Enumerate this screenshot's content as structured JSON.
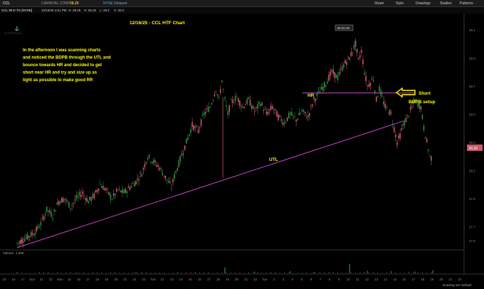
{
  "toolbar": {
    "symbol": "CCL",
    "company": "CARNIVAL CORP",
    "price": "28.20",
    "exchange": "NYSE Delayed",
    "share": "Share",
    "style": "Style",
    "drawings": "Drawings",
    "studies": "Studies",
    "patterns": "Patterns"
  },
  "infobar": {
    "desc": "CCL 30 D 7m [NYSE]",
    "date": "12/16/25 4:51 PM",
    "o": "O: 28.25",
    "h": "H: 28.26",
    "l": "L: 28.2",
    "c": "C: 28.2"
  },
  "logo_text": "CARNIVAL",
  "volume": {
    "label": "Volume",
    "value": "1,000"
  },
  "status": {
    "drawing_set": "Drawing set: Default"
  },
  "colors": {
    "up": "#2e8b3e",
    "down": "#c8586b",
    "trendline": "#cc44cc",
    "annotation": "#ffff00"
  },
  "chart_data": {
    "type": "candlestick",
    "title": "12/16/25 - CCL HTF Chart",
    "ylim": [
      27.55,
      29.2
    ],
    "y_ticks": [
      "29.1",
      "28.9",
      "28.7",
      "28.5",
      "28.3",
      "28.1",
      "27.9",
      "27.7",
      "27.6"
    ],
    "y_tick_values": [
      29.1,
      28.9,
      28.7,
      28.5,
      28.3,
      28.1,
      27.9,
      27.7,
      27.6
    ],
    "x_ticks": [
      "15",
      "16",
      "17",
      "Sun",
      "21",
      "22",
      "Mon",
      "15",
      "16",
      "17",
      "18",
      "19",
      "20",
      "21",
      "22",
      "23",
      "Tue",
      "12",
      "13",
      "14",
      "15",
      "16",
      "17",
      "18",
      "19",
      "20",
      "21",
      "22",
      "Tue",
      "2",
      "3",
      "4",
      "5",
      "6",
      "7",
      "8",
      "9",
      "10",
      "11",
      "12",
      "13",
      "14",
      "15",
      "16",
      "17",
      "18",
      "19",
      "20",
      "21",
      "22"
    ],
    "last_price": "28.20",
    "high_label": "09:20.08",
    "annotations": {
      "note": "In the afternoon I was scanning charts and noticed the BDPB through the UTL and bounce towards HR and decided to get short near HR and try and size up as tight as possible to make good RR",
      "hr": "HR",
      "utl": "UTL",
      "short": "Short",
      "setup": "BDPB setup"
    },
    "hr_level": 28.65,
    "utl_points": [
      [
        0,
        27.55
      ],
      [
        130,
        28.45
      ]
    ],
    "price_path": [
      [
        0,
        27.58
      ],
      [
        3,
        27.62
      ],
      [
        6,
        27.66
      ],
      [
        8,
        27.72
      ],
      [
        10,
        27.82
      ],
      [
        12,
        27.78
      ],
      [
        14,
        27.88
      ],
      [
        16,
        27.9
      ],
      [
        18,
        27.84
      ],
      [
        20,
        27.9
      ],
      [
        22,
        27.94
      ],
      [
        24,
        27.88
      ],
      [
        26,
        27.92
      ],
      [
        28,
        28.0
      ],
      [
        30,
        27.96
      ],
      [
        32,
        27.9
      ],
      [
        34,
        27.96
      ],
      [
        36,
        27.94
      ],
      [
        38,
        27.98
      ],
      [
        40,
        28.02
      ],
      [
        42,
        28.08
      ],
      [
        44,
        28.2
      ],
      [
        46,
        28.16
      ],
      [
        48,
        28.12
      ],
      [
        50,
        28.05
      ],
      [
        52,
        27.98
      ],
      [
        53,
        28.06
      ],
      [
        55,
        28.18
      ],
      [
        57,
        28.3
      ],
      [
        59,
        28.42
      ],
      [
        61,
        28.38
      ],
      [
        63,
        28.5
      ],
      [
        65,
        28.55
      ],
      [
        67,
        28.68
      ],
      [
        68,
        28.6
      ],
      [
        69,
        28.74
      ],
      [
        70,
        28.6
      ],
      [
        71,
        28.5
      ],
      [
        72,
        28.58
      ],
      [
        74,
        28.62
      ],
      [
        76,
        28.55
      ],
      [
        78,
        28.6
      ],
      [
        80,
        28.52
      ],
      [
        82,
        28.58
      ],
      [
        84,
        28.5
      ],
      [
        86,
        28.55
      ],
      [
        88,
        28.48
      ],
      [
        90,
        28.44
      ],
      [
        92,
        28.5
      ],
      [
        94,
        28.46
      ],
      [
        96,
        28.52
      ],
      [
        98,
        28.48
      ],
      [
        100,
        28.6
      ],
      [
        102,
        28.66
      ],
      [
        104,
        28.72
      ],
      [
        106,
        28.8
      ],
      [
        108,
        28.76
      ],
      [
        110,
        28.85
      ],
      [
        112,
        28.9
      ],
      [
        114,
        29.0
      ],
      [
        115,
        28.88
      ],
      [
        116,
        28.95
      ],
      [
        117,
        28.8
      ],
      [
        118,
        28.7
      ],
      [
        120,
        28.75
      ],
      [
        121,
        28.6
      ],
      [
        122,
        28.68
      ],
      [
        124,
        28.55
      ],
      [
        126,
        28.5
      ],
      [
        127,
        28.4
      ],
      [
        128,
        28.3
      ],
      [
        129,
        28.35
      ],
      [
        130,
        28.42
      ],
      [
        132,
        28.5
      ],
      [
        134,
        28.6
      ],
      [
        136,
        28.55
      ],
      [
        137,
        28.4
      ],
      [
        138,
        28.3
      ],
      [
        139,
        28.2
      ],
      [
        140,
        28.18
      ]
    ],
    "volume_bars": [
      [
        0,
        0.05
      ],
      [
        20,
        0.04
      ],
      [
        40,
        0.06
      ],
      [
        60,
        0.05
      ],
      [
        70,
        0.35
      ],
      [
        80,
        0.1
      ],
      [
        92,
        0.12
      ],
      [
        100,
        0.08
      ],
      [
        112,
        0.55
      ],
      [
        118,
        0.15
      ],
      [
        126,
        0.12
      ],
      [
        134,
        0.1
      ],
      [
        140,
        0.18
      ]
    ]
  }
}
